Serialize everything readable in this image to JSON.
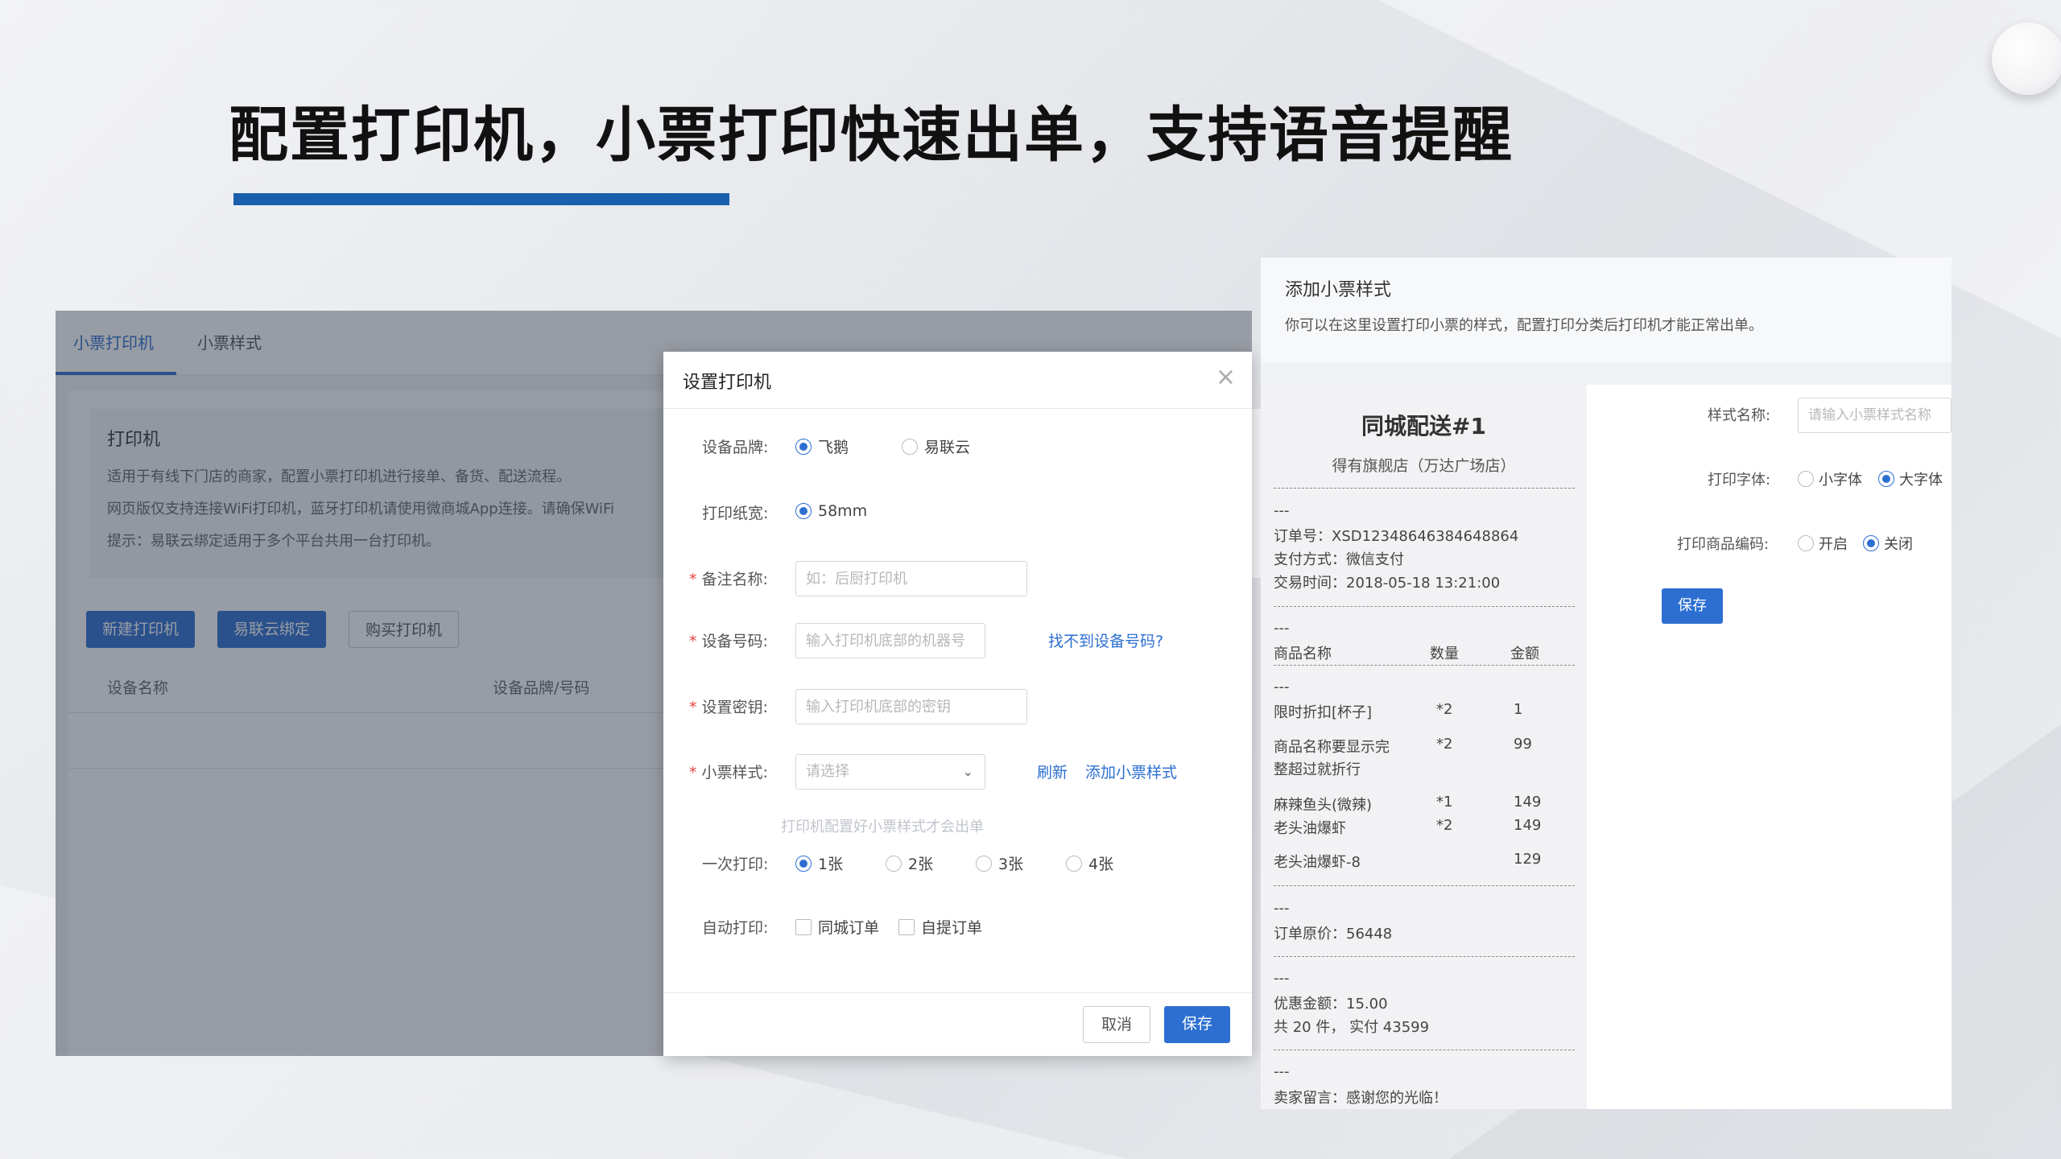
{
  "headline": "配置打印机，小票打印快速出单，支持语音提醒",
  "colors": {
    "accent": "#2c6fd1",
    "headline_bar": "#1a5fae",
    "required": "#e64545"
  },
  "admin": {
    "tabs": [
      "小票打印机",
      "小票样式"
    ],
    "info": {
      "title": "打印机",
      "lines": [
        "适用于有线下门店的商家，配置小票打印机进行接单、备货、配送流程。",
        "网页版仅支持连接WiFi打印机，蓝牙打印机请使用微商城App连接。请确保WiFi",
        "提示：易联云绑定适用于多个平台共用一台打印机。"
      ]
    },
    "buttons": [
      "新建打印机",
      "易联云绑定",
      "购买打印机"
    ],
    "table_headers": [
      "设备名称",
      "设备品牌/号码"
    ]
  },
  "modal": {
    "title": "设置打印机",
    "close_icon": "close-icon",
    "brand_label": "设备品牌:",
    "brand_options": [
      "飞鹅",
      "易联云"
    ],
    "brand_selected": "飞鹅",
    "paper_label": "打印纸宽:",
    "paper_option": "58mm",
    "name_label": "备注名称:",
    "name_placeholder": "如：后厨打印机",
    "device_label": "设备号码:",
    "device_placeholder": "输入打印机底部的机器号",
    "device_link": "找不到设备号码?",
    "key_label": "设置密钥:",
    "key_placeholder": "输入打印机底部的密钥",
    "style_label": "小票样式:",
    "style_placeholder": "请选择",
    "refresh_link": "刷新",
    "add_style_link": "添加小票样式",
    "style_hint": "打印机配置好小票样式才会出单",
    "copies_label": "一次打印:",
    "copies_options": [
      "1张",
      "2张",
      "3张",
      "4张"
    ],
    "copies_selected": "1张",
    "auto_label": "自动打印:",
    "auto_options": [
      "同城订单",
      "自提订单"
    ],
    "cancel": "取消",
    "save": "保存"
  },
  "style_panel": {
    "title": "添加小票样式",
    "desc": "你可以在这里设置打印小票的样式，配置打印分类后打印机才能正常出单。",
    "receipt": {
      "title": "同城配送#1",
      "shop": "得有旗舰店（万达广场店）",
      "sep": "---",
      "order_no": "订单号：XSD12348646384648864",
      "pay": "支付方式：微信支付",
      "time": "交易时间：2018-05-18    13:21:00",
      "cols": [
        "商品名称",
        "数量",
        "金额"
      ],
      "items": [
        {
          "name": "限时折扣[杯子]",
          "qty": "*2",
          "amount": "1"
        },
        {
          "name": "商品名称要显示完",
          "name2": "整超过就折行",
          "qty": "*2",
          "amount": "99"
        },
        {
          "name": "麻辣鱼头(微辣)",
          "qty": "*1",
          "amount": "149"
        },
        {
          "name": "老头油爆虾",
          "qty": "*2",
          "amount": "149"
        },
        {
          "name": "老头油爆虾-8",
          "qty": "",
          "amount": "129"
        }
      ],
      "original": "订单原价：56448",
      "discount": "优惠金额：15.00",
      "total": "共 20 件，   实付 43599",
      "message": "卖家留言：感谢您的光临！"
    },
    "form": {
      "name_label": "样式名称:",
      "name_placeholder": "请输入小票样式名称",
      "font_label": "打印字体:",
      "font_options": [
        "小字体",
        "大字体"
      ],
      "font_selected": "大字体",
      "code_label": "打印商品编码:",
      "code_options": [
        "开启",
        "关闭"
      ],
      "code_selected": "关闭",
      "save": "保存"
    }
  }
}
